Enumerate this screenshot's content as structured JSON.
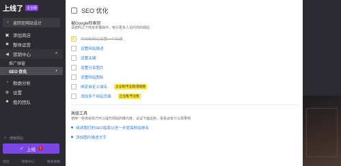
{
  "sidebar": {
    "brand": "上线了",
    "brand_badge": "企业版",
    "back": "返回至网站设计",
    "items": [
      {
        "icon": "doc-icon",
        "label": "添加商店"
      },
      {
        "icon": "chat-icon",
        "label": "整体运营"
      },
      {
        "icon": "megaphone-icon",
        "label": "营销中心"
      }
    ],
    "subitems": [
      {
        "label": "推广弹窗"
      },
      {
        "label": "SEO 优化"
      }
    ],
    "items2": [
      {
        "icon": "chart-icon",
        "label": "数据分析"
      },
      {
        "icon": "gear-icon",
        "label": "设置"
      },
      {
        "icon": "team-icon",
        "label": "我的团队"
      }
    ],
    "search_placeholder": "搜索网站",
    "upload_label": "上线",
    "upload_badge": "!",
    "footer": [
      "退出",
      "帮助中心",
      "联系客服"
    ]
  },
  "panel": {
    "title": "SEO 优化",
    "section1_title": "被Google检索到",
    "section1_desc": "请按照以下简单步骤操作，吸引更多人访问你的网站",
    "tasks": [
      {
        "label": "为你的网站设置一个标题",
        "done": true
      },
      {
        "label": "设置网站描述",
        "done": false
      },
      {
        "label": "设置关键",
        "done": false
      },
      {
        "label": "设置分享图片",
        "done": false
      },
      {
        "label": "设置网站图标",
        "done": false
      },
      {
        "label": "绑定自定义域名",
        "done": false,
        "badge": "企业版/专业版/基础版"
      },
      {
        "label": "添加多个网站页面",
        "done": false,
        "badge": "企业版/专业版"
      }
    ],
    "section2_title": "高级工具",
    "section2_desc": "使用一些高级技巧可以提升网站的曝光度，试试下面这些，看看会有什么效果吧",
    "tools": [
      {
        "label": "阅读我们的SEO指南以进一步提高网站排名"
      },
      {
        "label": "添加图片描述文字"
      }
    ]
  }
}
